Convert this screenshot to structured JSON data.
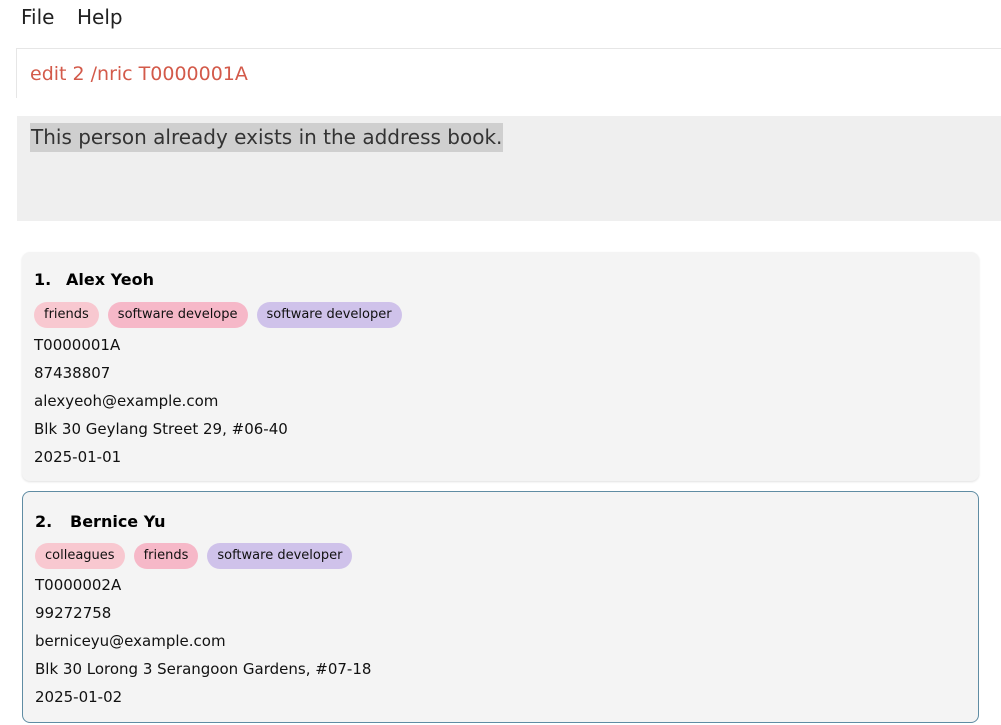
{
  "menu": {
    "file": "File",
    "help": "Help"
  },
  "command": {
    "value": "edit 2 /nric T0000001A"
  },
  "result": {
    "message": "This person already exists in the address book."
  },
  "persons": [
    {
      "index": "1.",
      "name": "Alex Yeoh",
      "tags": [
        "friends",
        "software develope",
        "software developer"
      ],
      "nric": "T0000001A",
      "phone": "87438807",
      "email": "alexyeoh@example.com",
      "address": "Blk 30 Geylang Street 29, #06-40",
      "date": "2025-01-01"
    },
    {
      "index": "2.",
      "name": "Bernice Yu",
      "tags": [
        "colleagues",
        "friends",
        "software developer"
      ],
      "nric": "T0000002A",
      "phone": "99272758",
      "email": "berniceyu@example.com",
      "address": "Blk 30 Lorong 3 Serangoon Gardens, #07-18",
      "date": "2025-01-02"
    }
  ],
  "colors": {
    "command_text": "#d35a4a",
    "selected_border": "#5f8ca3",
    "tag_pink": "#f8c8d0",
    "tag_purple": "#cfc2ea"
  }
}
